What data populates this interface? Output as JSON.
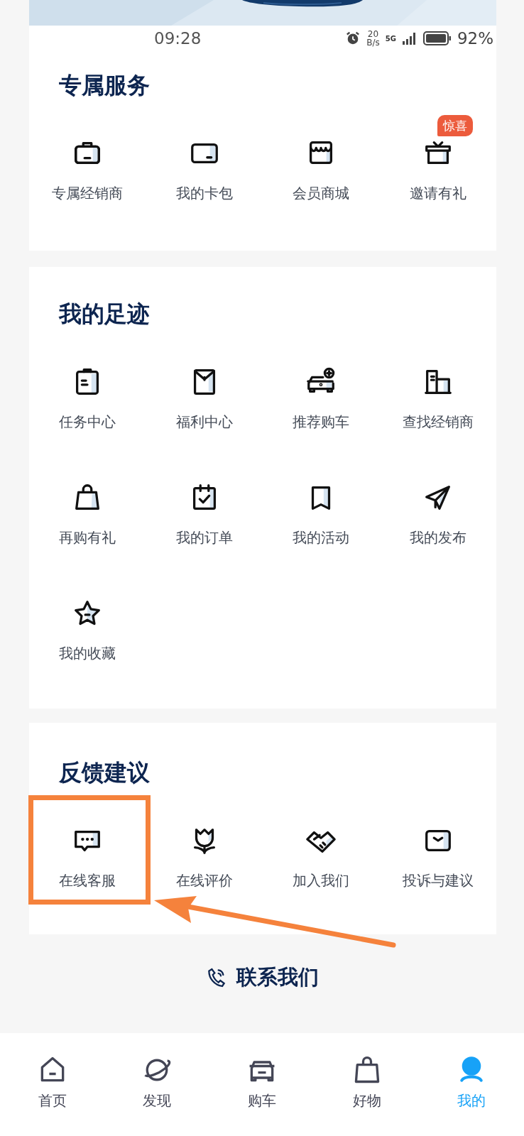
{
  "status_bar": {
    "time": "09:28",
    "net_speed_value": "20",
    "net_speed_unit": "B/s",
    "network": "5G",
    "battery": "92%"
  },
  "sections": [
    {
      "title": "专属服务",
      "items": [
        {
          "label": "专属经销商"
        },
        {
          "label": "我的卡包"
        },
        {
          "label": "会员商城"
        },
        {
          "label": "邀请有礼",
          "badge": "惊喜"
        }
      ]
    },
    {
      "title": "我的足迹",
      "items": [
        {
          "label": "任务中心"
        },
        {
          "label": "福利中心"
        },
        {
          "label": "推荐购车"
        },
        {
          "label": "查找经销商"
        },
        {
          "label": "再购有礼"
        },
        {
          "label": "我的订单"
        },
        {
          "label": "我的活动"
        },
        {
          "label": "我的发布"
        },
        {
          "label": "我的收藏"
        }
      ]
    },
    {
      "title": "反馈建议",
      "items": [
        {
          "label": "在线客服",
          "highlighted": true
        },
        {
          "label": "在线评价",
          "highlighted": false
        },
        {
          "label": "加入我们",
          "highlighted": false
        },
        {
          "label": "投诉与建议",
          "highlighted": false
        }
      ]
    }
  ],
  "contact": {
    "label": "联系我们"
  },
  "tab_bar": [
    {
      "label": "首页",
      "selected": false
    },
    {
      "label": "发现",
      "selected": false
    },
    {
      "label": "购车",
      "selected": false
    },
    {
      "label": "好物",
      "selected": false
    },
    {
      "label": "我的",
      "selected": true
    }
  ]
}
